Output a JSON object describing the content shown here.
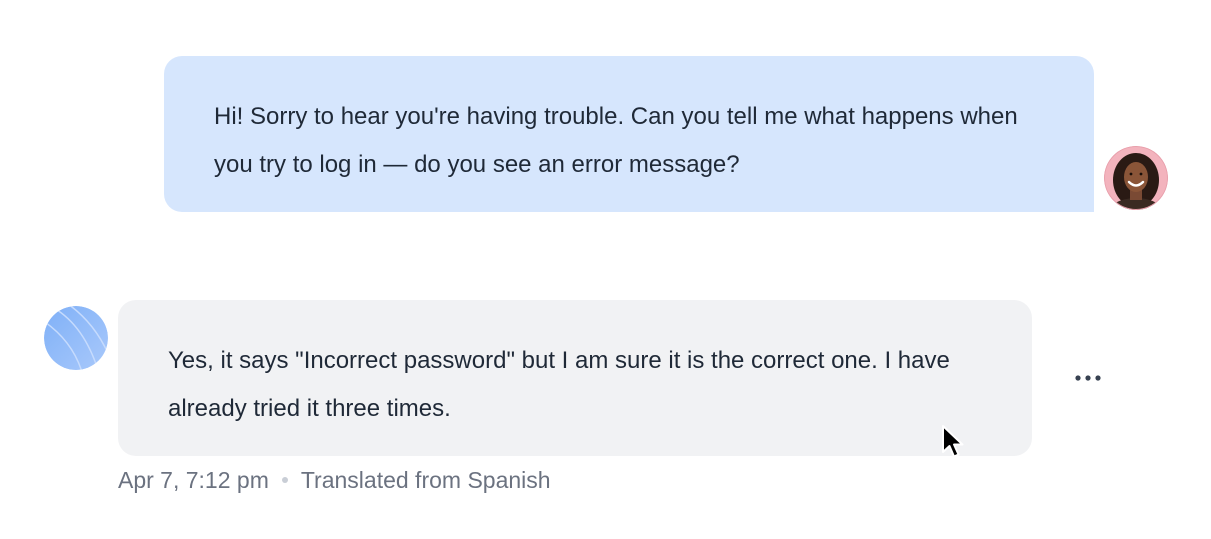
{
  "conversation": {
    "agent_message": {
      "text": "Hi! Sorry to hear you're having trouble. Can you tell me what happens when you try to log in — do you see an error message?"
    },
    "customer_message": {
      "text": "Yes, it says \"Incorrect password\" but I am sure it is the correct one. I have already tried it three times.",
      "timestamp": "Apr 7, 7:12 pm",
      "translation_note": "Translated from Spanish"
    }
  },
  "icons": {
    "more_actions": "more-horizontal-icon",
    "cursor": "mouse-pointer-icon"
  },
  "colors": {
    "agent_bubble": "#d6e6fd",
    "customer_bubble": "#f1f2f4",
    "text": "#1f2937",
    "meta_text": "#6b7280"
  }
}
